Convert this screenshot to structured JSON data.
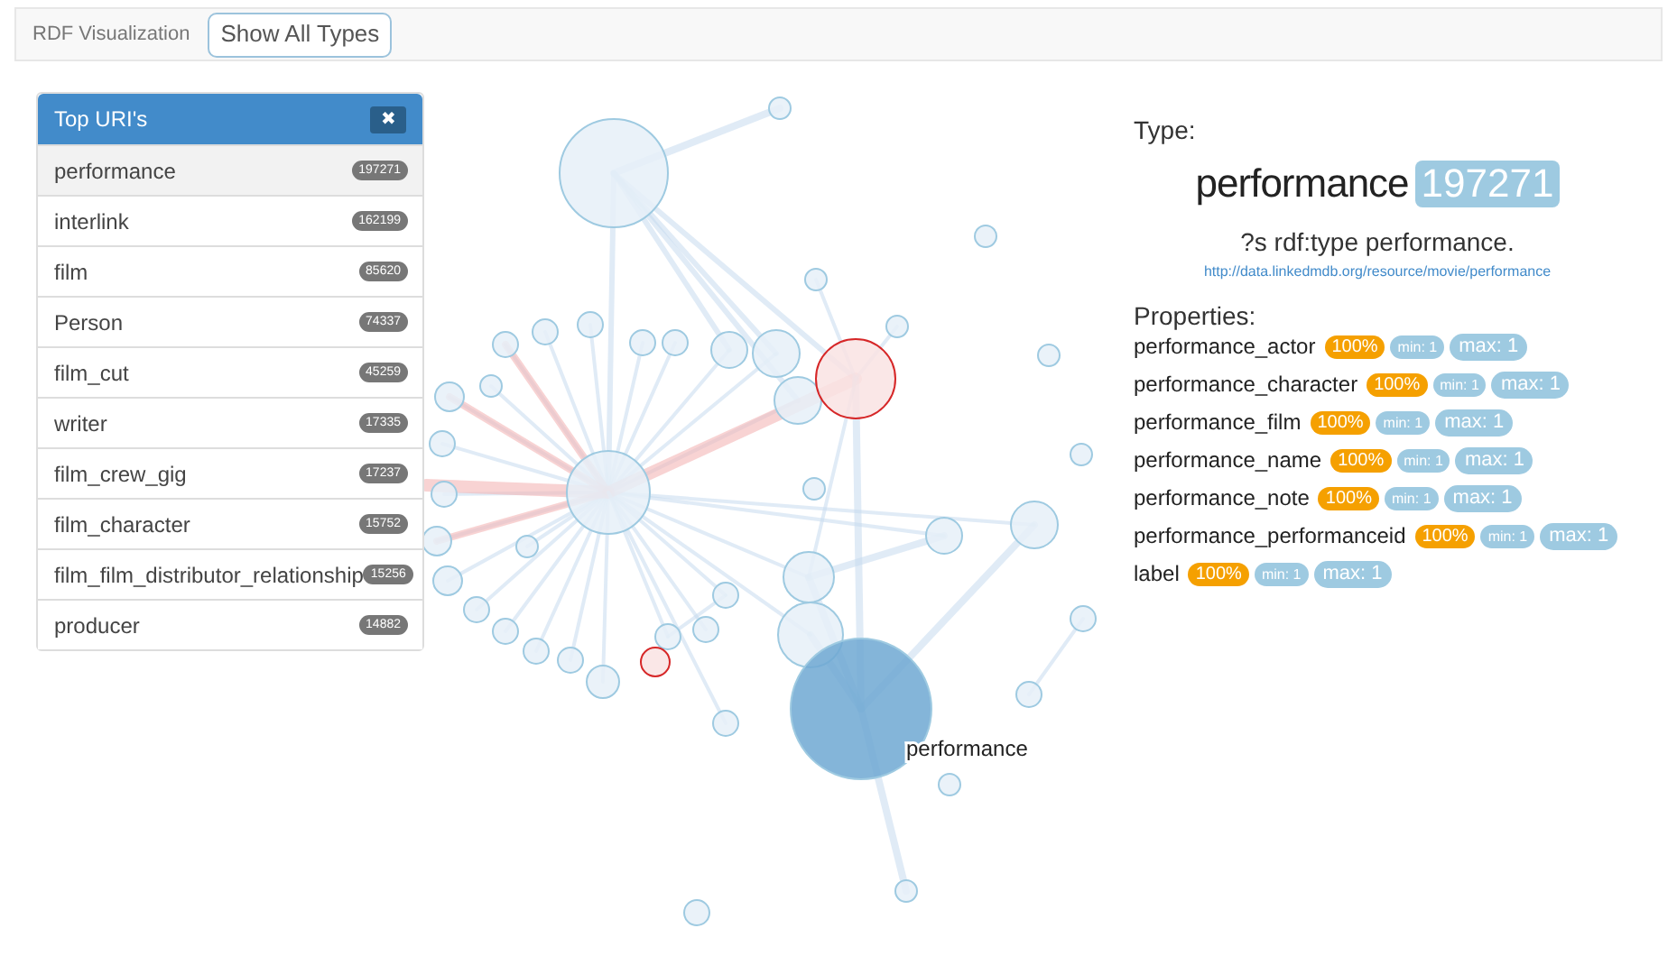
{
  "navbar": {
    "brand": "RDF Visualization",
    "button": "Show All Types"
  },
  "top_uris": {
    "title": "Top URI's",
    "close": "✖",
    "items": [
      {
        "label": "performance",
        "count": "197271",
        "selected": true
      },
      {
        "label": "interlink",
        "count": "162199",
        "selected": false
      },
      {
        "label": "film",
        "count": "85620",
        "selected": false
      },
      {
        "label": "Person",
        "count": "74337",
        "selected": false
      },
      {
        "label": "film_cut",
        "count": "45259",
        "selected": false
      },
      {
        "label": "writer",
        "count": "17335",
        "selected": false
      },
      {
        "label": "film_crew_gig",
        "count": "17237",
        "selected": false
      },
      {
        "label": "film_character",
        "count": "15752",
        "selected": false
      },
      {
        "label": "film_film_distributor_relationship",
        "count": "15256",
        "selected": false
      },
      {
        "label": "producer",
        "count": "14882",
        "selected": false
      }
    ]
  },
  "graph": {
    "label": "performance"
  },
  "details": {
    "type_heading": "Type:",
    "type_name": "performance",
    "type_count": "197271",
    "query": "?s rdf:type performance.",
    "uri": "http://data.linkedmdb.org/resource/movie/performance",
    "properties_heading": "Properties:",
    "properties": [
      {
        "name": "performance_actor",
        "coverage": "100%",
        "min": "min: 1",
        "max": "max: 1"
      },
      {
        "name": "performance_character",
        "coverage": "100%",
        "min": "min: 1",
        "max": "max: 1"
      },
      {
        "name": "performance_film",
        "coverage": "100%",
        "min": "min: 1",
        "max": "max: 1"
      },
      {
        "name": "performance_name",
        "coverage": "100%",
        "min": "min: 1",
        "max": "max: 1"
      },
      {
        "name": "performance_note",
        "coverage": "100%",
        "min": "min: 1",
        "max": "max: 1"
      },
      {
        "name": "performance_performanceid",
        "coverage": "100%",
        "min": "min: 1",
        "max": "max: 1"
      },
      {
        "name": "label",
        "coverage": "100%",
        "min": "min: 1",
        "max": "max: 1"
      }
    ]
  }
}
